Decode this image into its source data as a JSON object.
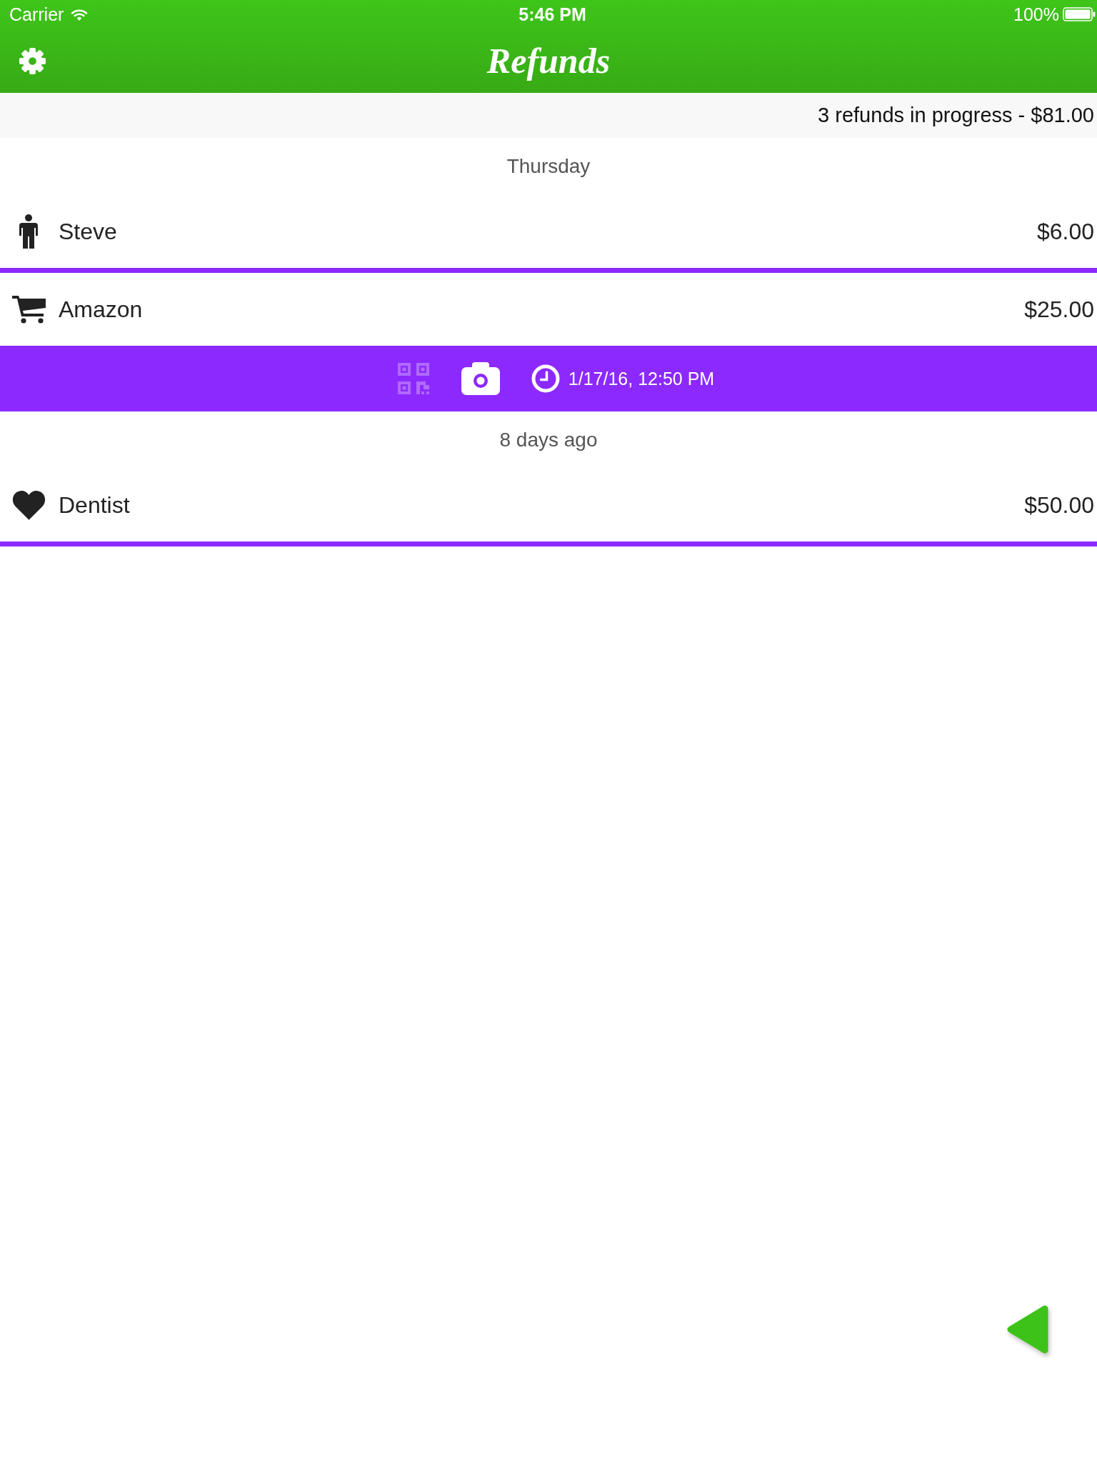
{
  "status_bar": {
    "carrier": "Carrier",
    "time": "5:46 PM",
    "battery": "100%"
  },
  "nav_bar": {
    "title": "Refunds"
  },
  "summary": {
    "text": "3 refunds in progress - $81.00"
  },
  "sections": [
    {
      "header": "Thursday",
      "refunds": [
        {
          "kind": "person",
          "name": "Steve",
          "amount": "$6.00",
          "expanded": false
        },
        {
          "kind": "cart",
          "name": "Amazon",
          "amount": "$25.00",
          "expanded": true,
          "details": {
            "qr_code": false,
            "photo": true,
            "date": "1/17/16, 12:50 PM"
          }
        }
      ]
    },
    {
      "header": "8 days ago",
      "refunds": [
        {
          "kind": "heart",
          "name": "Dentist",
          "amount": "$50.00",
          "expanded": false
        }
      ]
    }
  ]
}
